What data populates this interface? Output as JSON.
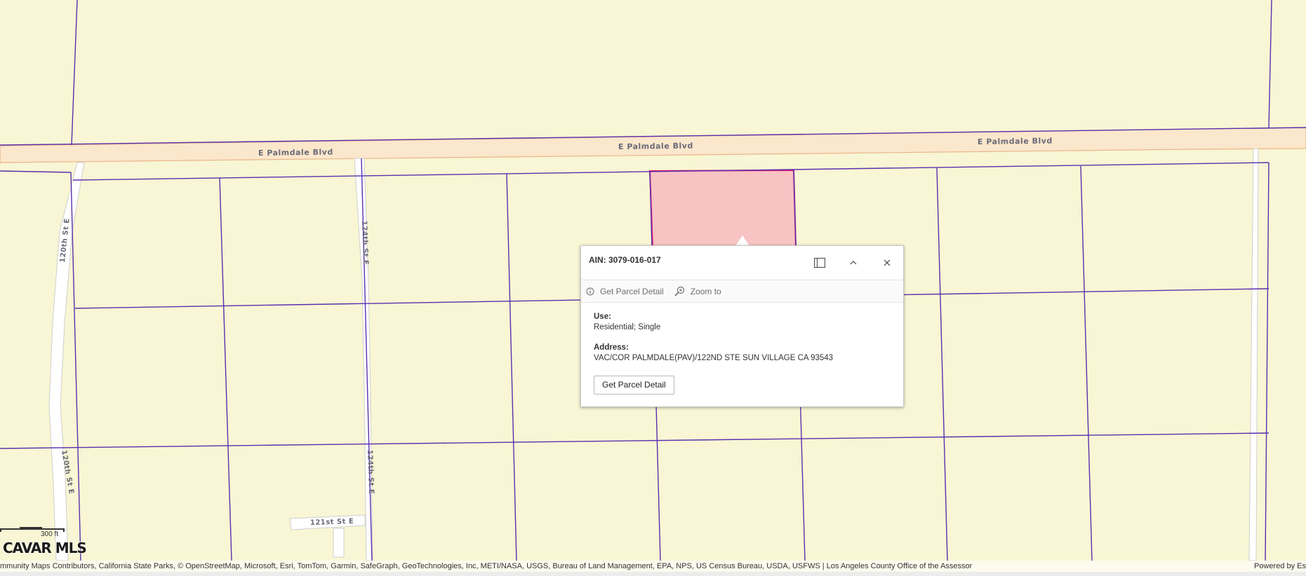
{
  "roads": {
    "palmdale_1": "E Palmdale Blvd",
    "palmdale_2": "E Palmdale Blvd",
    "palmdale_3": "E Palmdale Blvd",
    "st120_north": "120th St E",
    "st120_south": "120th St E",
    "st124_north": "124th St E",
    "st124_south": "124th St E",
    "st121": "121st St E"
  },
  "popup": {
    "title": "AIN: 3079-016-017",
    "actions": {
      "detail": "Get Parcel Detail",
      "zoom": "Zoom to"
    },
    "fields": {
      "use_label": "Use:",
      "use_value": "Residential; Single",
      "address_label": "Address:",
      "address_value": "VAC/COR PALMDALE(PAV)/122ND STE SUN VILLAGE CA 93543"
    },
    "button_label": "Get Parcel Detail"
  },
  "scale": {
    "label": "300 ft"
  },
  "logo": {
    "text": "CAVAR MLS"
  },
  "attribution": {
    "text": "mmunity Maps Contributors, California State Parks, © OpenStreetMap, Microsoft, Esri, TomTom, Garmin, SafeGraph, GeoTechnologies, Inc, METI/NASA, USGS, Bureau of Land Management, EPA, NPS, US Census Bureau, USDA, USFWS | Los Angeles County Office of the Assessor",
    "powered": "Powered by Es"
  },
  "colors": {
    "land": "#f8f6d4",
    "parcel_line": "#5b2fae",
    "highlight_fill": "#f8c3c3",
    "highlight_stroke": "#d61a6a",
    "road_fill": "#fbe7cc",
    "road_edge": "#e9b689"
  }
}
